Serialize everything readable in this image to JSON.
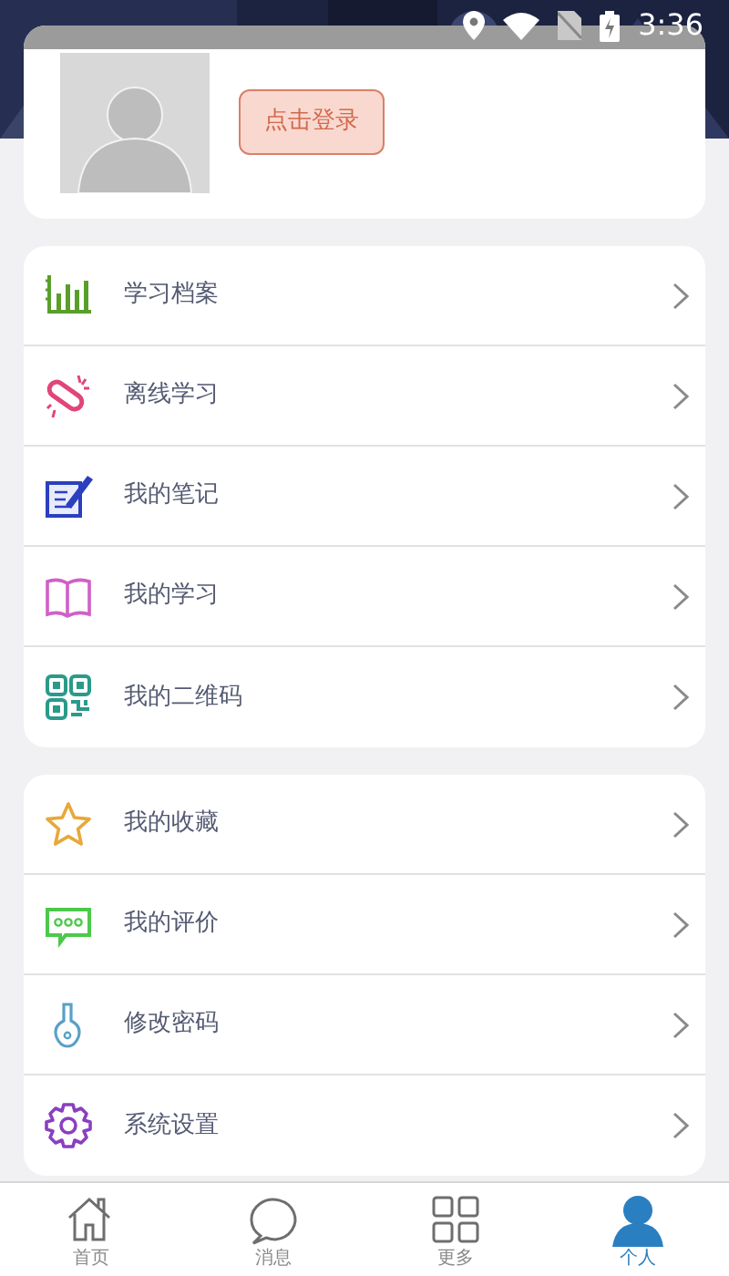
{
  "status_bar": {
    "time": "3:36"
  },
  "profile": {
    "login_button": "点击登录"
  },
  "menu_groups": [
    {
      "items": [
        {
          "label": "学习档案"
        },
        {
          "label": "离线学习"
        },
        {
          "label": "我的笔记"
        },
        {
          "label": "我的学习"
        },
        {
          "label": "我的二维码"
        }
      ]
    },
    {
      "items": [
        {
          "label": "我的收藏"
        },
        {
          "label": "我的评价"
        },
        {
          "label": "修改密码"
        },
        {
          "label": "系统设置"
        }
      ]
    }
  ],
  "tab_bar": [
    {
      "label": "首页",
      "selected": false
    },
    {
      "label": "消息",
      "selected": false
    },
    {
      "label": "更多",
      "selected": false
    },
    {
      "label": "个人",
      "selected": true
    }
  ]
}
